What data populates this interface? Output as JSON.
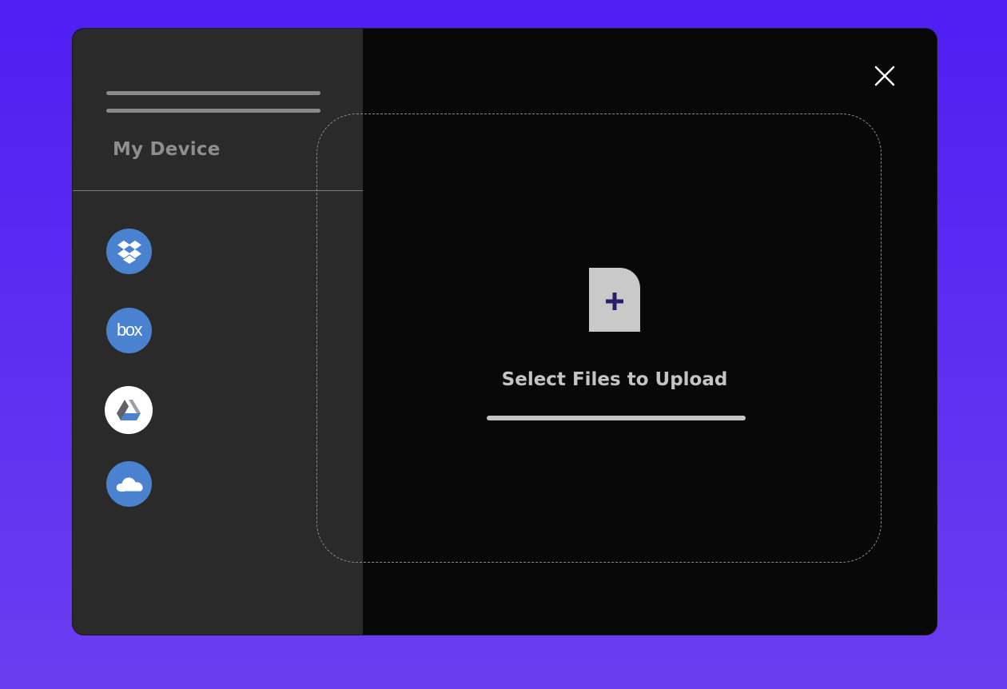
{
  "sidebar": {
    "menu_icon": "hamburger-icon",
    "device_label": "My Device",
    "providers": [
      {
        "name": "Dropbox",
        "icon": "dropbox-icon",
        "color": "#4a82cf"
      },
      {
        "name": "Box",
        "icon": "box-icon",
        "label": "box",
        "color": "#4a82cf"
      },
      {
        "name": "Google Drive",
        "icon": "google-drive-icon",
        "color": "#ffffff"
      },
      {
        "name": "OneDrive",
        "icon": "onedrive-icon",
        "color": "#4a82cf"
      }
    ]
  },
  "main": {
    "close_icon": "close-icon",
    "upload_icon": "add-file-icon",
    "upload_label": "Select Files to Upload",
    "progress": 1.0
  },
  "colors": {
    "background": "#5a2cf0",
    "dialog": "#080808",
    "sidebar": "#2a2a2a",
    "accent": "#2a1f6b"
  }
}
